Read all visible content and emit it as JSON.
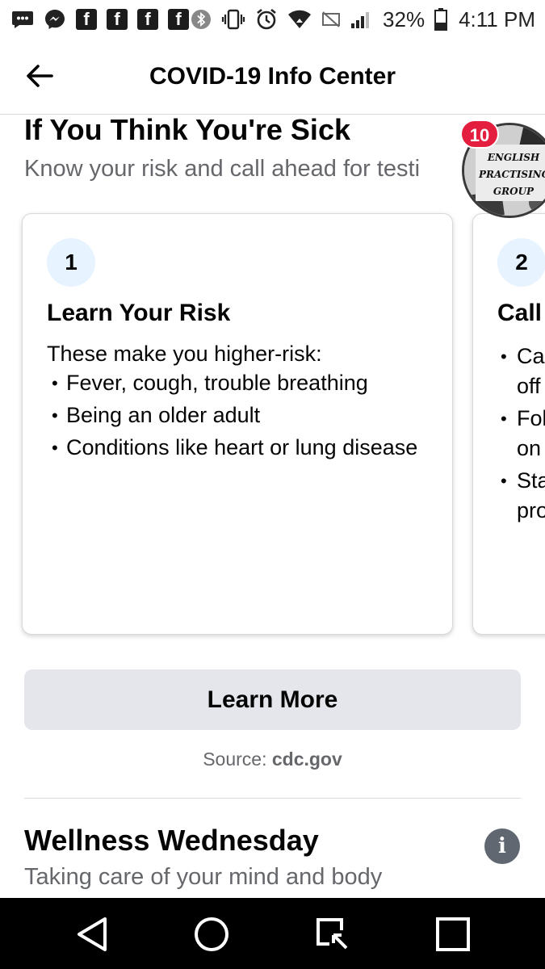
{
  "status_bar": {
    "left_icons": [
      "sms-icon",
      "messenger-icon",
      "facebook-icon",
      "facebook-icon",
      "facebook-icon",
      "facebook-icon"
    ],
    "right_icons": [
      "bluetooth-icon",
      "vibrate-icon",
      "alarm-icon",
      "wifi-icon",
      "no-data-icon",
      "signal-icon"
    ],
    "battery_percent": "32%",
    "time": "4:11 PM"
  },
  "header": {
    "title": "COVID-19 Info Center"
  },
  "section": {
    "title": "If You Think You're Sick",
    "subtitle": "Know your risk and call ahead for testi"
  },
  "chat_bubble": {
    "badge_count": "10",
    "label": "ENGLISH\nPRACTISING\nGROUP"
  },
  "cards": [
    {
      "number": "1",
      "title": "Learn Your Risk",
      "intro": "These make you higher-risk:",
      "bullets": [
        "Fever, cough, trouble breathing",
        "Being an older adult",
        "Conditions like heart or lung disease"
      ]
    },
    {
      "number": "2",
      "title": "Call",
      "bullets": [
        "Ca\noff",
        "Fol\non",
        "Sta\npro"
      ]
    }
  ],
  "learn_more": {
    "label": "Learn More"
  },
  "source": {
    "prefix": "Source: ",
    "domain": "cdc.gov"
  },
  "wellness": {
    "title": "Wellness Wednesday",
    "subtitle": "Taking care of your mind and body"
  },
  "colors": {
    "accent_badge": "#e41e3f",
    "step_circle": "#e7f3ff",
    "button_bg": "#e4e6eb",
    "secondary_text": "#65676b"
  }
}
